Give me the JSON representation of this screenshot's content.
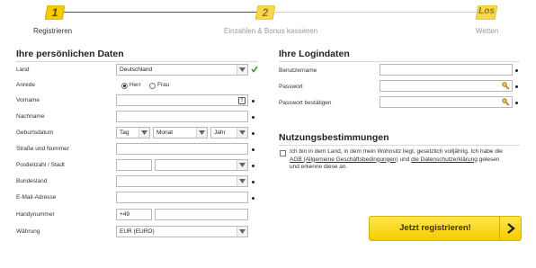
{
  "steps": [
    {
      "badge": "1",
      "label": "Registrieren",
      "state": "active"
    },
    {
      "badge": "2",
      "label": "Einzahlen & Bonus kassieren",
      "state": "todo"
    },
    {
      "badge": "Los",
      "label": "Wetten",
      "state": "todo"
    }
  ],
  "personal": {
    "heading": "Ihre persönlichen Daten",
    "land_label": "Land",
    "land_value": "Deutschland",
    "anrede_label": "Anrede",
    "anrede_options": [
      "Herr",
      "Frau"
    ],
    "anrede_selected": "Herr",
    "vorname_label": "Vorname",
    "nachname_label": "Nachname",
    "geburtsdatum_label": "Geburtsdatum",
    "birth_day": "Tag",
    "birth_month": "Monat",
    "birth_year": "Jahr",
    "strasse_label": "Straße und Nummer",
    "plz_label": "Postleitzahl / Stadt",
    "bundesland_label": "Bundesland",
    "email_label": "E-Mail-Adresse",
    "handy_label": "Handynummer",
    "handy_prefix": "+49",
    "waehrung_label": "Währung",
    "waehrung_value": "EUR (EURO)"
  },
  "login": {
    "heading": "Ihre Logindaten",
    "username_label": "Benutzername",
    "password_label": "Passwort",
    "password_confirm_label": "Passwort bestätigen"
  },
  "terms": {
    "heading": "Nutzungsbestimmungen",
    "text_1": "Ich bin in dem Land, in dem mein Wohnsitz liegt, gesetzlich volljährig. Ich habe die",
    "agb_link": "AGB (Allgemeine Geschäftsbedingungen)",
    "text_2": "und",
    "privacy_link": "die Datenschutzerklärung",
    "text_3": "gelesen",
    "text_4": "und erkenne diese an."
  },
  "cta": {
    "label": "Jetzt registrieren!"
  },
  "colors": {
    "accent_yellow": "#f6cb00",
    "valid_green": "#3c9a2f"
  },
  "icons": {
    "valid": "check-icon",
    "info": "info-icon",
    "password": "key-icon",
    "submit": "chevron-right-icon",
    "dropdown": "caret-down-icon"
  }
}
